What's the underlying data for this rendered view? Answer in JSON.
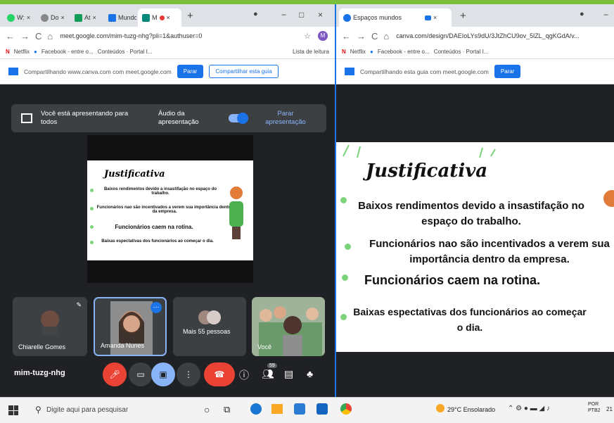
{
  "left_browser": {
    "tabs": [
      "W:",
      "Do",
      "At",
      "Mundo",
      "M"
    ],
    "url": "meet.google.com/mim-tuzg-nhg?pli=1&authuser=0",
    "bookmarks": [
      "Netflix",
      "Facebook - entre o...",
      "Conteúdos · Portal I...",
      "Lista de leitura"
    ],
    "share_text": "Compartilhando www.canva.com com meet.google.com",
    "share_button": "Parar",
    "share_tab_button": "Compartilhar esta guia"
  },
  "right_browser": {
    "tab_title": "Espaços mundos",
    "url": "canva.com/design/DAEIoLYs9dU/3JtZhCU9ov_5lZL_qgKGdA/v...",
    "bookmarks": [
      "Netflix",
      "Facebook - entre o...",
      "Conteúdos · Portal I..."
    ],
    "share_text": "Compartilhando esta guia com meet.google.com",
    "share_button": "Parar"
  },
  "meet": {
    "presenting_text": "Você está apresentando para todos",
    "audio_label": "Áudio da apresentação",
    "stop_label": "Parar apresentação",
    "meeting_code": "mim-tuzg-nhg",
    "participants": [
      {
        "name": "Chiarelle Gomes"
      },
      {
        "name": "Amanda Nunes"
      },
      {
        "name": "Mais 55 pessoas"
      },
      {
        "name": "Você"
      }
    ],
    "participant_count": "59"
  },
  "slide": {
    "title": "Justificativa",
    "bullets": [
      "Baixos rendimentos devido a insastifação no espaço do trabalho.",
      "Funcionários nao são incentivados a verem sua importância dentro da empresa.",
      "Funcionários caem na rotina.",
      "Baixas espectativas dos funcionários ao começar o dia."
    ]
  },
  "taskbar": {
    "search_placeholder": "Digite aqui para pesquisar",
    "weather": "29°C Ensolarado",
    "lang": "POR PTB2",
    "time": "21"
  },
  "colors": {
    "meet_bg": "#202124",
    "accent": "#1a73e8",
    "bullet": "#7cd37c",
    "end_call": "#ea4335"
  }
}
